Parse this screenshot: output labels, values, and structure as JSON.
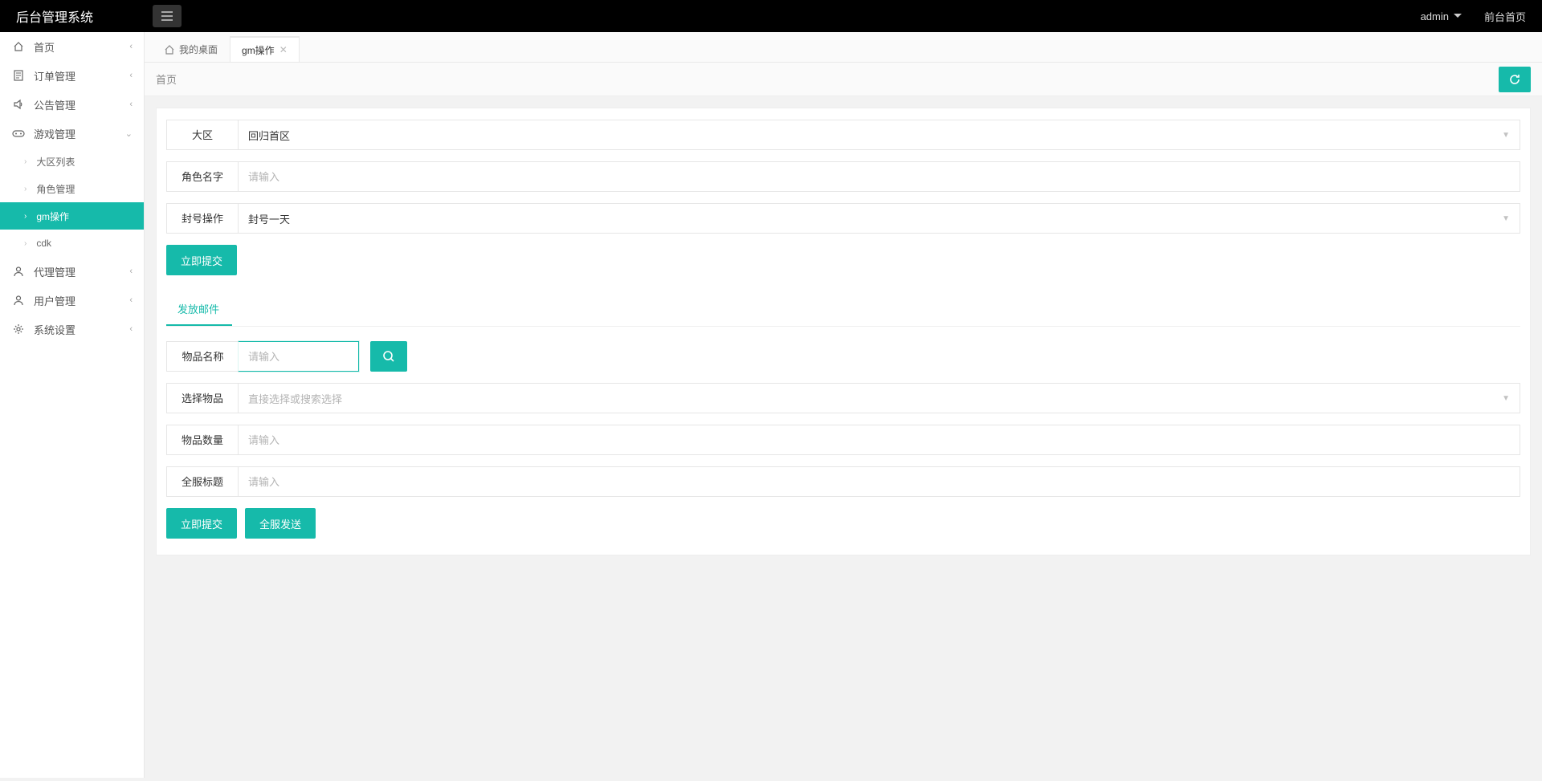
{
  "header": {
    "brand": "后台管理系统",
    "user": "admin",
    "front_link": "前台首页"
  },
  "sidebar": {
    "items": [
      {
        "label": "首页",
        "icon": "home"
      },
      {
        "label": "订单管理",
        "icon": "doc"
      },
      {
        "label": "公告管理",
        "icon": "speaker"
      },
      {
        "label": "游戏管理",
        "icon": "game",
        "expanded": true
      },
      {
        "label": "代理管理",
        "icon": "user"
      },
      {
        "label": "用户管理",
        "icon": "user"
      },
      {
        "label": "系统设置",
        "icon": "gear"
      }
    ],
    "submenu": [
      {
        "label": "大区列表"
      },
      {
        "label": "角色管理"
      },
      {
        "label": "gm操作",
        "active": true
      },
      {
        "label": "cdk"
      }
    ]
  },
  "tabs": {
    "home": "我的桌面",
    "active": "gm操作"
  },
  "breadcrumb": {
    "text": "首页"
  },
  "form1": {
    "region_label": "大区",
    "region_value": "回归首区",
    "role_label": "角色名字",
    "role_placeholder": "请输入",
    "ban_label": "封号操作",
    "ban_value": "封号一天",
    "submit": "立即提交"
  },
  "section_tab": "发放邮件",
  "form2": {
    "item_name_label": "物品名称",
    "item_name_placeholder": "请输入",
    "select_item_label": "选择物品",
    "select_item_placeholder": "直接选择或搜索选择",
    "item_qty_label": "物品数量",
    "item_qty_placeholder": "请输入",
    "title_label": "全服标题",
    "title_placeholder": "请输入",
    "submit": "立即提交",
    "send_all": "全服发送"
  }
}
